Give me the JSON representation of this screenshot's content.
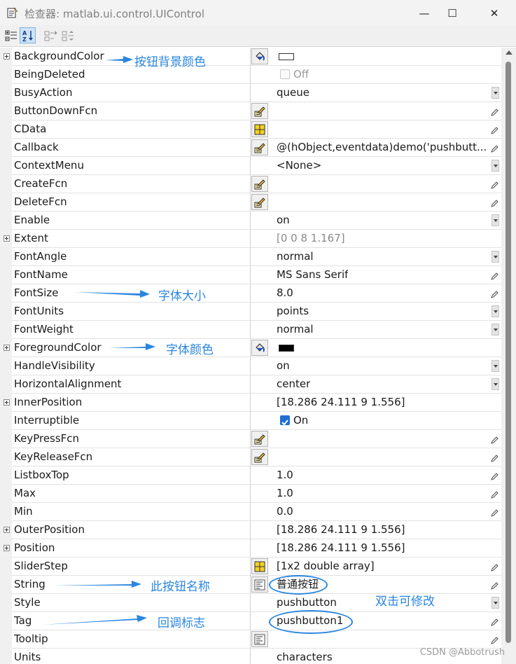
{
  "window": {
    "title": "检查器:  matlab.ui.control.UIControl",
    "minimize": "—",
    "maximize": "☐",
    "close": "✕"
  },
  "toolbar": {
    "items": [
      "categorize",
      "sort-alphabetically",
      "expand-all",
      "collapse-all"
    ]
  },
  "properties": [
    {
      "name": "BackgroundColor",
      "expandable": true,
      "button": "color",
      "kind": "swatch",
      "swatch_color": "#ffffff"
    },
    {
      "name": "BeingDeleted",
      "kind": "checkbox",
      "checked": false,
      "value": "Off"
    },
    {
      "name": "BusyAction",
      "kind": "dropdown",
      "value": "queue"
    },
    {
      "name": "ButtonDownFcn",
      "button": "callback",
      "kind": "edit",
      "value": ""
    },
    {
      "name": "CData",
      "button": "array",
      "kind": "edit",
      "value": ""
    },
    {
      "name": "Callback",
      "button": "callback",
      "kind": "edit",
      "value": "@(hObject,eventdata)demo('pushbutt..."
    },
    {
      "name": "ContextMenu",
      "kind": "dropdown",
      "value": "<None>"
    },
    {
      "name": "CreateFcn",
      "button": "callback",
      "kind": "edit",
      "value": ""
    },
    {
      "name": "DeleteFcn",
      "button": "callback",
      "kind": "edit",
      "value": ""
    },
    {
      "name": "Enable",
      "kind": "dropdown",
      "value": "on"
    },
    {
      "name": "Extent",
      "expandable": true,
      "kind": "readonly",
      "value": "[0 0 8 1.167]"
    },
    {
      "name": "FontAngle",
      "kind": "dropdown",
      "value": "normal"
    },
    {
      "name": "FontName",
      "kind": "edit",
      "value": "MS Sans Serif"
    },
    {
      "name": "FontSize",
      "kind": "edit",
      "value": "8.0"
    },
    {
      "name": "FontUnits",
      "kind": "dropdown",
      "value": "points"
    },
    {
      "name": "FontWeight",
      "kind": "dropdown",
      "value": "normal"
    },
    {
      "name": "ForegroundColor",
      "expandable": true,
      "button": "color",
      "kind": "swatch",
      "swatch_color": "#000000"
    },
    {
      "name": "HandleVisibility",
      "kind": "dropdown",
      "value": "on"
    },
    {
      "name": "HorizontalAlignment",
      "kind": "dropdown",
      "value": "center"
    },
    {
      "name": "InnerPosition",
      "expandable": true,
      "kind": "plain",
      "value": "[18.286 24.111 9 1.556]"
    },
    {
      "name": "Interruptible",
      "kind": "checkbox",
      "checked": true,
      "value": "On"
    },
    {
      "name": "KeyPressFcn",
      "button": "callback",
      "kind": "edit",
      "value": ""
    },
    {
      "name": "KeyReleaseFcn",
      "button": "callback",
      "kind": "edit",
      "value": ""
    },
    {
      "name": "ListboxTop",
      "kind": "edit",
      "value": "1.0"
    },
    {
      "name": "Max",
      "kind": "edit",
      "value": "1.0"
    },
    {
      "name": "Min",
      "kind": "edit",
      "value": "0.0"
    },
    {
      "name": "OuterPosition",
      "expandable": true,
      "kind": "plain",
      "value": "[18.286 24.111 9 1.556]"
    },
    {
      "name": "Position",
      "expandable": true,
      "kind": "plain",
      "value": "[18.286 24.111 9 1.556]"
    },
    {
      "name": "SliderStep",
      "button": "array",
      "kind": "edit",
      "value": "[1x2  double array]"
    },
    {
      "name": "String",
      "button": "text",
      "kind": "edit",
      "value": "普通按钮"
    },
    {
      "name": "Style",
      "kind": "dropdown",
      "value": "pushbutton"
    },
    {
      "name": "Tag",
      "kind": "edit",
      "value": "pushbutton1"
    },
    {
      "name": "Tooltip",
      "button": "text",
      "kind": "edit",
      "value": ""
    },
    {
      "name": "Units",
      "kind": "plain",
      "value": "characters"
    }
  ],
  "annotations": {
    "bgcolor": "按钮背景颜色",
    "fontsize": "字体大小",
    "fgcolor": "字体颜色",
    "string": "此按钮名称",
    "dblclick": "双击可修改",
    "tag": "回调标志"
  },
  "watermark": "CSDN @Abbotrush",
  "colors": {
    "accent": "#2a86e0",
    "checkbox": "#1f6fd1"
  }
}
